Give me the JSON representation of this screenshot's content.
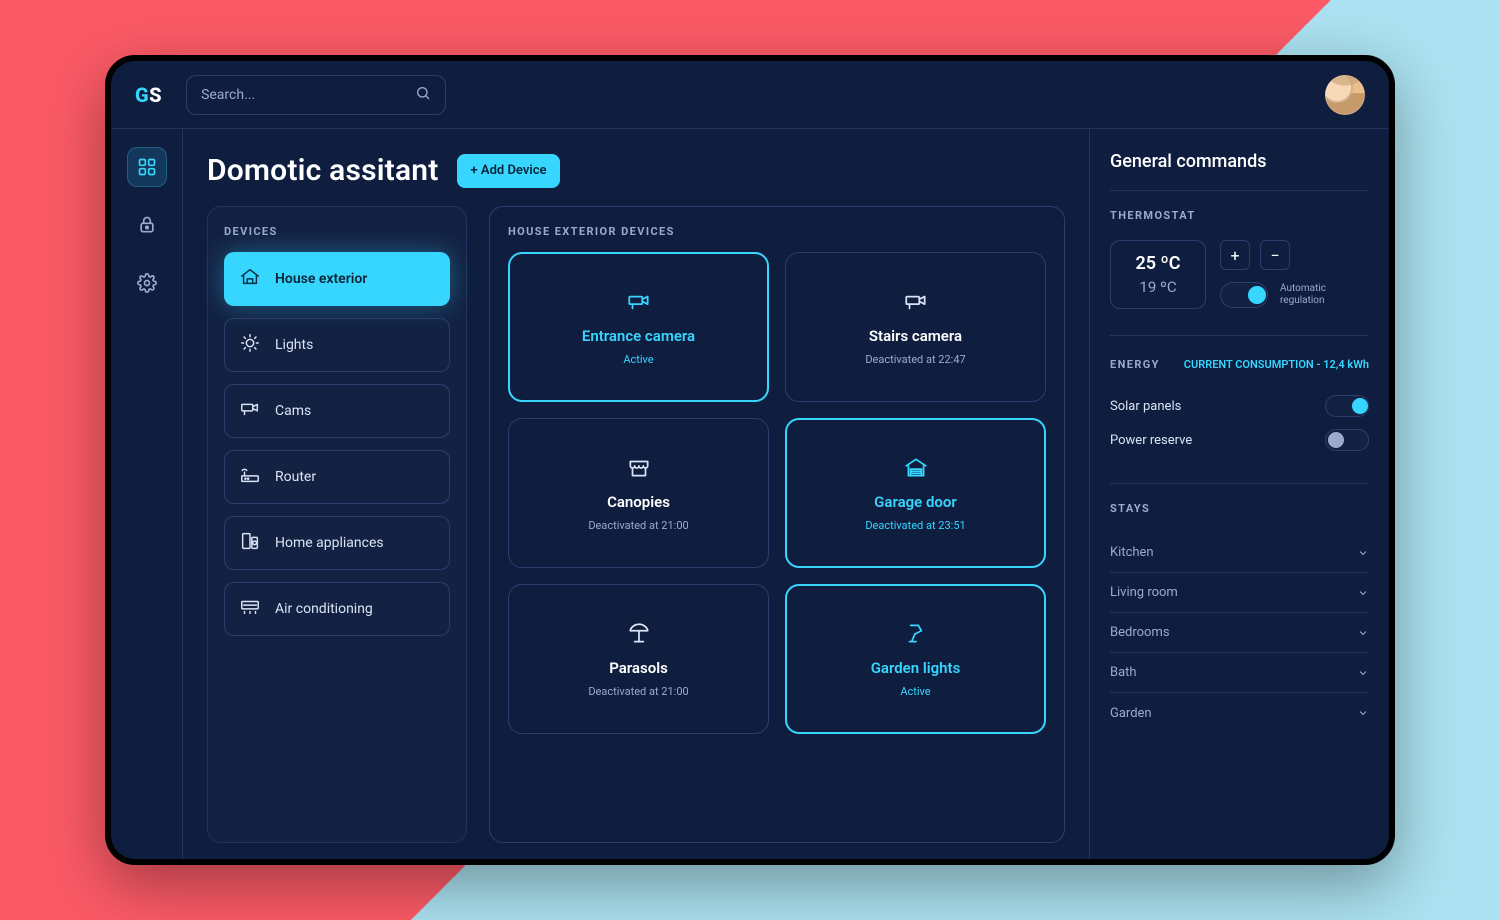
{
  "logo": {
    "g": "G",
    "s": "S"
  },
  "search": {
    "placeholder": "Search..."
  },
  "pageTitle": "Domotic assitant",
  "addDevice": "+ Add Device",
  "sidebar": {
    "devicesTitle": "DEVICES",
    "items": [
      {
        "label": "House exterior",
        "active": true,
        "icon": "house"
      },
      {
        "label": "Lights",
        "active": false,
        "icon": "light"
      },
      {
        "label": "Cams",
        "active": false,
        "icon": "cam"
      },
      {
        "label": "Router",
        "active": false,
        "icon": "router"
      },
      {
        "label": "Home appliances",
        "active": false,
        "icon": "appliance"
      },
      {
        "label": "Air conditioning",
        "active": false,
        "icon": "ac"
      }
    ]
  },
  "grid": {
    "title": "HOUSE EXTERIOR DEVICES",
    "cards": [
      {
        "name": "Entrance camera",
        "state": "Active",
        "active": true,
        "icon": "cam"
      },
      {
        "name": "Stairs camera",
        "state": "Deactivated at 22:47",
        "active": false,
        "icon": "cam"
      },
      {
        "name": "Canopies",
        "state": "Deactivated at 21:00",
        "active": false,
        "icon": "canopy"
      },
      {
        "name": "Garage door",
        "state": "Deactivated at 23:51",
        "active": true,
        "icon": "garage"
      },
      {
        "name": "Parasols",
        "state": "Deactivated at 21:00",
        "active": false,
        "icon": "parasol"
      },
      {
        "name": "Garden lights",
        "state": "Active",
        "active": true,
        "icon": "lamp"
      }
    ]
  },
  "right": {
    "title": "General commands",
    "thermostatTitle": "THERMOSTAT",
    "thermo": {
      "t1": "25 ºC",
      "t2": "19 ºC"
    },
    "autoReg": "Automatic\nregulation",
    "energyTitle": "ENERGY",
    "consumption": "CURRENT CONSUMPTION - 12,4 kWh",
    "energy": [
      {
        "label": "Solar panels",
        "on": true
      },
      {
        "label": "Power reserve",
        "on": false
      }
    ],
    "staysTitle": "STAYS",
    "stays": [
      "Kitchen",
      "Living room",
      "Bedrooms",
      "Bath",
      "Garden"
    ]
  }
}
